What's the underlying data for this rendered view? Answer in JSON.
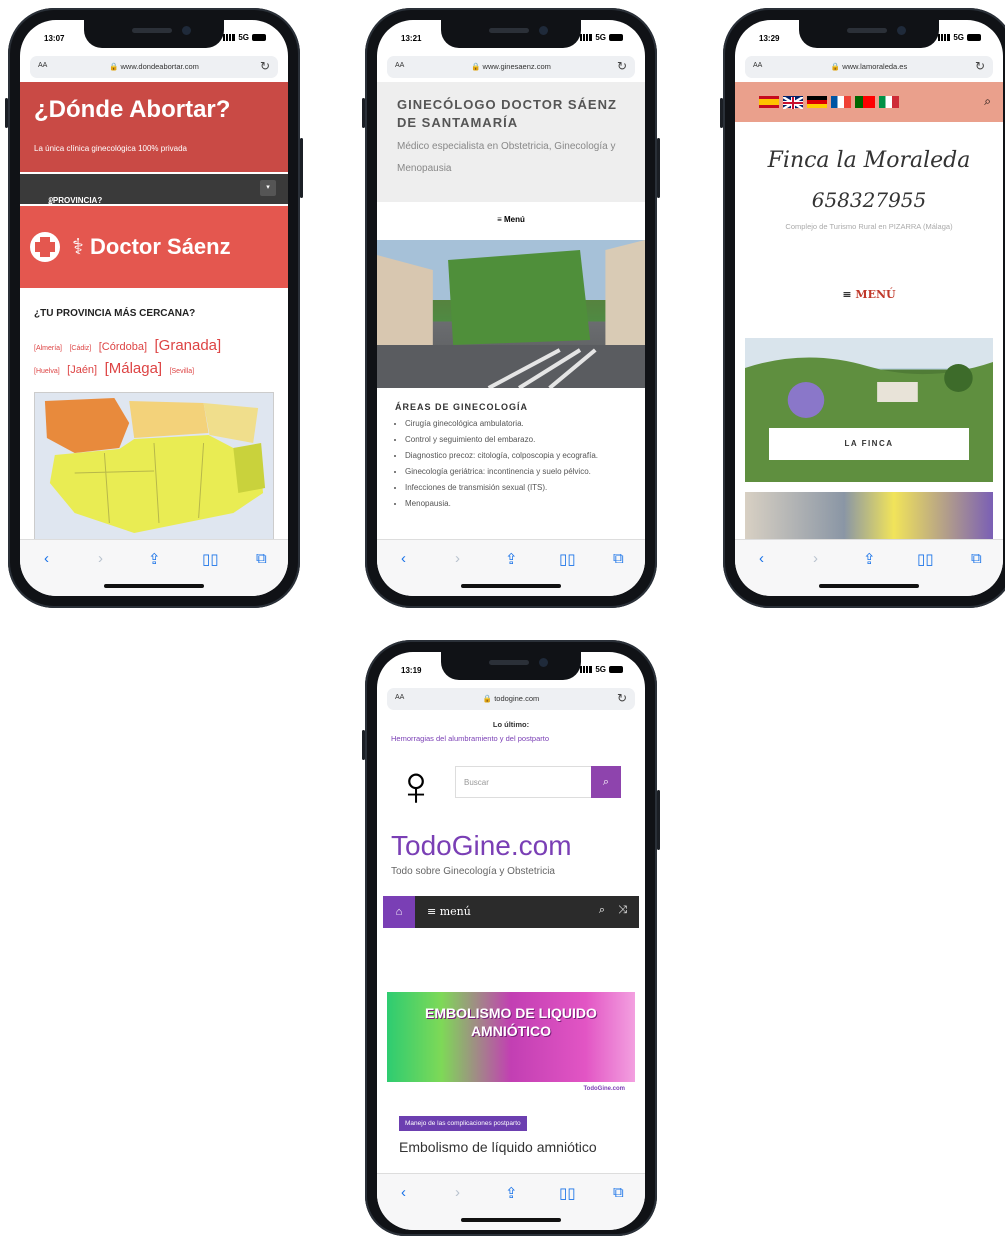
{
  "phones": [
    {
      "time": "13:07",
      "url": "www.dondeabortar.com",
      "aa": "AA",
      "network": "5G",
      "title": "¿Dónde Abortar?",
      "subtitle": "La única clínica ginecológica 100% privada",
      "province_dropdown": "¿PROVINCIA?",
      "doctor_banner": "Doctor Sáenz",
      "question": "¿TU PROVINCIA MÁS CERCANA?",
      "provinces": [
        "[Almería]",
        "[Cádiz]",
        "[Córdoba]",
        "[Granada]",
        "[Huelva]",
        "[Jaén]",
        "[Málaga]",
        "[Sevilla]"
      ]
    },
    {
      "time": "13:21",
      "url": "www.ginesaenz.com",
      "aa": "AA",
      "network": "5G",
      "site_title": "GINECÓLOGO DOCTOR SÁENZ DE SANTAMARÍA",
      "site_subtitle": "Médico especialista en Obstetricia, Ginecología y Menopausia",
      "menu_label": "Menú",
      "areas_title": "ÁREAS DE GINECOLOGÍA",
      "areas": [
        "Cirugía ginecológica ambulatoria.",
        "Control y seguimiento del embarazo.",
        "Diagnostico precoz: citología, colposcopia y ecografía.",
        "Ginecología geriátrica: incontinencia y suelo pélvico.",
        "Infecciones de transmisión sexual (ITS).",
        "Menopausia."
      ]
    },
    {
      "time": "13:29",
      "url": "www.lamoraleda.es",
      "aa": "AA",
      "network": "5G",
      "name": "Finca la Moraleda",
      "phone": "658327955",
      "description": "Complejo de Turismo Rural en PIZARRA (Málaga)",
      "menu_label": "MENÚ",
      "finca_button": "LA FINCA",
      "flags": [
        "#c60b1e",
        "#012169",
        "#000000",
        "#0055a4",
        "#006600",
        "#009246"
      ]
    },
    {
      "time": "13:19",
      "url": "todogine.com",
      "aa": "AA",
      "network": "5G",
      "latest_label": "Lo último:",
      "latest_link": "Hemorragias del alumbramiento y del postparto",
      "search_placeholder": "Buscar",
      "brand": "TodoGine.com",
      "tagline": "Todo sobre Ginecología y Obstetricia",
      "nav_menu": "menú",
      "banner_text": "EMBOLISMO DE LIQUIDO AMNIÓTICO",
      "banner_signature": "TodoGine.com",
      "category": "Manejo de las complicaciones postparto",
      "article_title": "Embolismo de líquido amniótico"
    }
  ]
}
